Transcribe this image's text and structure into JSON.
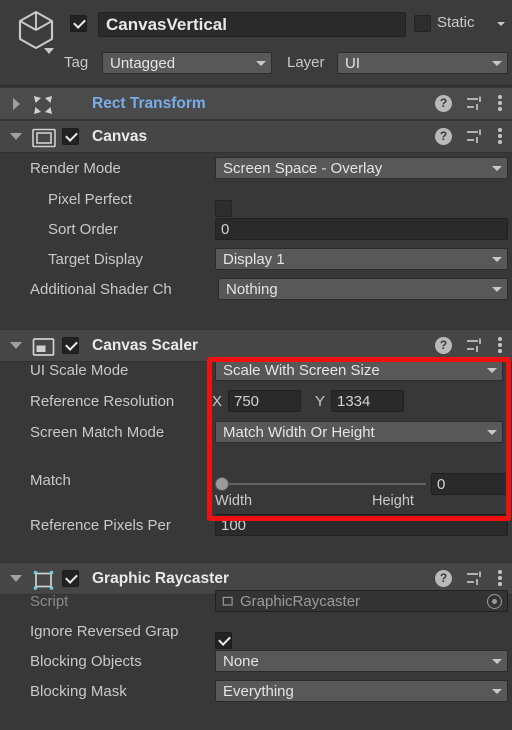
{
  "gameobject": {
    "icon": "cube-icon",
    "enabled": true,
    "name": "CanvasVertical",
    "static_label": "Static",
    "static_checked": false,
    "tag_label": "Tag",
    "tag_value": "Untagged",
    "layer_label": "Layer",
    "layer_value": "UI"
  },
  "components": [
    {
      "title": "Rect Transform",
      "icon": "rect-transform-icon",
      "expanded": false,
      "has_checkbox": false,
      "title_color": "#7aaeea"
    },
    {
      "title": "Canvas",
      "icon": "canvas-icon",
      "expanded": true,
      "has_checkbox": true,
      "checked": true
    },
    {
      "title": "Canvas Scaler",
      "icon": "canvas-scaler-icon",
      "expanded": true,
      "has_checkbox": true,
      "checked": true
    },
    {
      "title": "Graphic Raycaster",
      "icon": "graphic-raycaster-icon",
      "expanded": true,
      "has_checkbox": true,
      "checked": true
    }
  ],
  "header_icons": {
    "help": "?",
    "preset": "preset-icon",
    "menu": "three-dot-menu-icon"
  },
  "canvas": {
    "render_mode_label": "Render Mode",
    "render_mode_value": "Screen Space - Overlay",
    "pixel_perfect_label": "Pixel Perfect",
    "pixel_perfect_checked": false,
    "sort_order_label": "Sort Order",
    "sort_order_value": "0",
    "target_display_label": "Target Display",
    "target_display_value": "Display 1",
    "additional_shader_label": "Additional Shader Ch",
    "additional_shader_value": "Nothing"
  },
  "canvas_scaler": {
    "ui_scale_mode_label": "UI Scale Mode",
    "ui_scale_mode_value": "Scale With Screen Size",
    "reference_resolution_label": "Reference Resolution",
    "ref_x_label": "X",
    "ref_x_value": "750",
    "ref_y_label": "Y",
    "ref_y_value": "1334",
    "screen_match_mode_label": "Screen Match Mode",
    "screen_match_mode_value": "Match Width Or Height",
    "match_label": "Match",
    "match_value": "0",
    "match_min_label": "Width",
    "match_max_label": "Height",
    "reference_pixels_label": "Reference Pixels Per",
    "reference_pixels_value": "100"
  },
  "graphic_raycaster": {
    "script_label": "Script",
    "script_value": "GraphicRaycaster",
    "ignore_reversed_label": "Ignore Reversed Grap",
    "ignore_reversed_checked": true,
    "blocking_objects_label": "Blocking Objects",
    "blocking_objects_value": "None",
    "blocking_mask_label": "Blocking Mask",
    "blocking_mask_value": "Everything"
  },
  "highlight": {
    "color": "#ee1111"
  }
}
